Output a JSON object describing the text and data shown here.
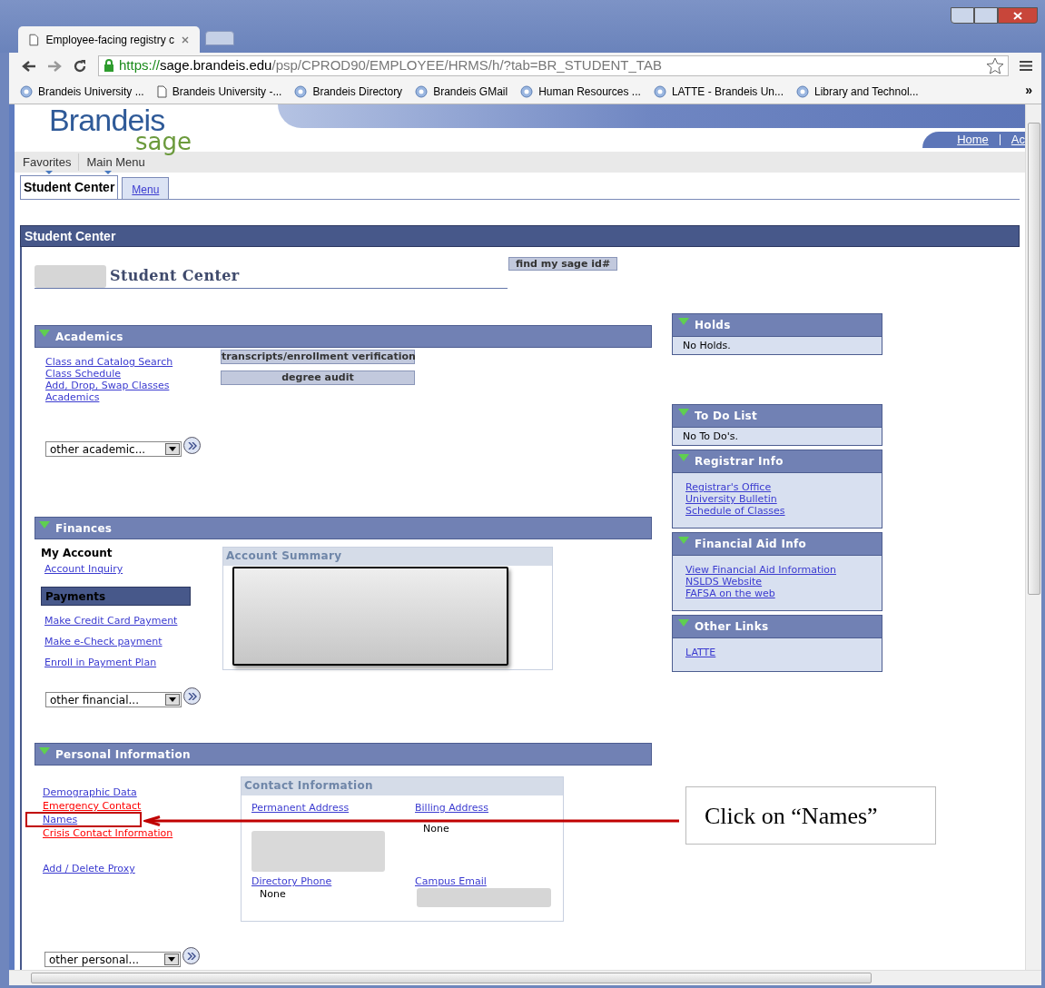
{
  "browser": {
    "tab_title": "Employee-facing registry c",
    "url_scheme": "https://",
    "url_host": "sage.brandeis.edu",
    "url_path": "/psp/CPROD90/EMPLOYEE/HRMS/h/?tab=BR_STUDENT_TAB",
    "bookmarks": [
      {
        "label": "Brandeis University ...",
        "kind": "site"
      },
      {
        "label": "Brandeis University -...",
        "kind": "page"
      },
      {
        "label": "Brandeis Directory",
        "kind": "site"
      },
      {
        "label": "Brandeis GMail",
        "kind": "site"
      },
      {
        "label": "Human Resources ...",
        "kind": "site"
      },
      {
        "label": "LATTE - Brandeis Un...",
        "kind": "site"
      },
      {
        "label": "Library and Technol...",
        "kind": "site"
      }
    ],
    "more": "»"
  },
  "header": {
    "logo": "Brandeis",
    "logo_sub": "sage",
    "links": [
      "Home",
      "Ac"
    ]
  },
  "menu": [
    "Favorites",
    "Main Menu"
  ],
  "tabs": [
    {
      "label": "Student Center",
      "selected": true
    },
    {
      "label": "Menu",
      "selected": false
    }
  ],
  "title_bar": "Student Center",
  "heading": "Student Center",
  "find_button": "find my sage id#",
  "academics": {
    "title": "Academics",
    "links": [
      "Class and Catalog Search",
      "Class Schedule",
      "Add, Drop, Swap Classes",
      "Academics"
    ],
    "buttons": [
      "transcripts/enrollment verification",
      "degree audit"
    ],
    "dropdown": "other academic..."
  },
  "finances": {
    "title": "Finances",
    "my_account": "My Account",
    "account_links": [
      "Account Inquiry"
    ],
    "payments": "Payments",
    "payment_links": [
      "Make Credit Card Payment",
      "Make e-Check payment",
      "Enroll in Payment Plan"
    ],
    "summary_title": "Account Summary",
    "dropdown": "other financial..."
  },
  "personal": {
    "title": "Personal Information",
    "links": [
      {
        "label": "Demographic Data",
        "color": "#3b3bd0"
      },
      {
        "label": "Emergency Contact",
        "color": "#ff0000"
      },
      {
        "label": "Names",
        "color": "#3b3bd0"
      },
      {
        "label": "Crisis Contact Information",
        "color": "#ff0000"
      }
    ],
    "proxy_link": "Add / Delete Proxy",
    "contact": {
      "title": "Contact Information",
      "fields": [
        {
          "label": "Permanent Address",
          "kind": "redacted"
        },
        {
          "label": "Billing Address",
          "kind": "text",
          "value": "None"
        },
        {
          "label": "Directory Phone",
          "kind": "text",
          "value": "None"
        },
        {
          "label": "Campus Email",
          "kind": "redacted"
        }
      ]
    },
    "dropdown": "other personal..."
  },
  "panels": [
    {
      "title": "Holds",
      "kind": "text",
      "text": "No Holds."
    },
    {
      "title": "To Do List",
      "kind": "text",
      "text": "No To Do's."
    },
    {
      "title": "Registrar Info",
      "kind": "links",
      "links": [
        "Registrar's Office",
        "University Bulletin",
        "Schedule of Classes"
      ]
    },
    {
      "title": "Financial Aid Info",
      "kind": "links",
      "links": [
        "View Financial Aid Information",
        "NSLDS Website",
        "FAFSA on the web"
      ]
    },
    {
      "title": "Other Links",
      "kind": "links",
      "links": [
        "LATTE"
      ]
    }
  ],
  "callout": {
    "text": "Click on “Names”"
  }
}
